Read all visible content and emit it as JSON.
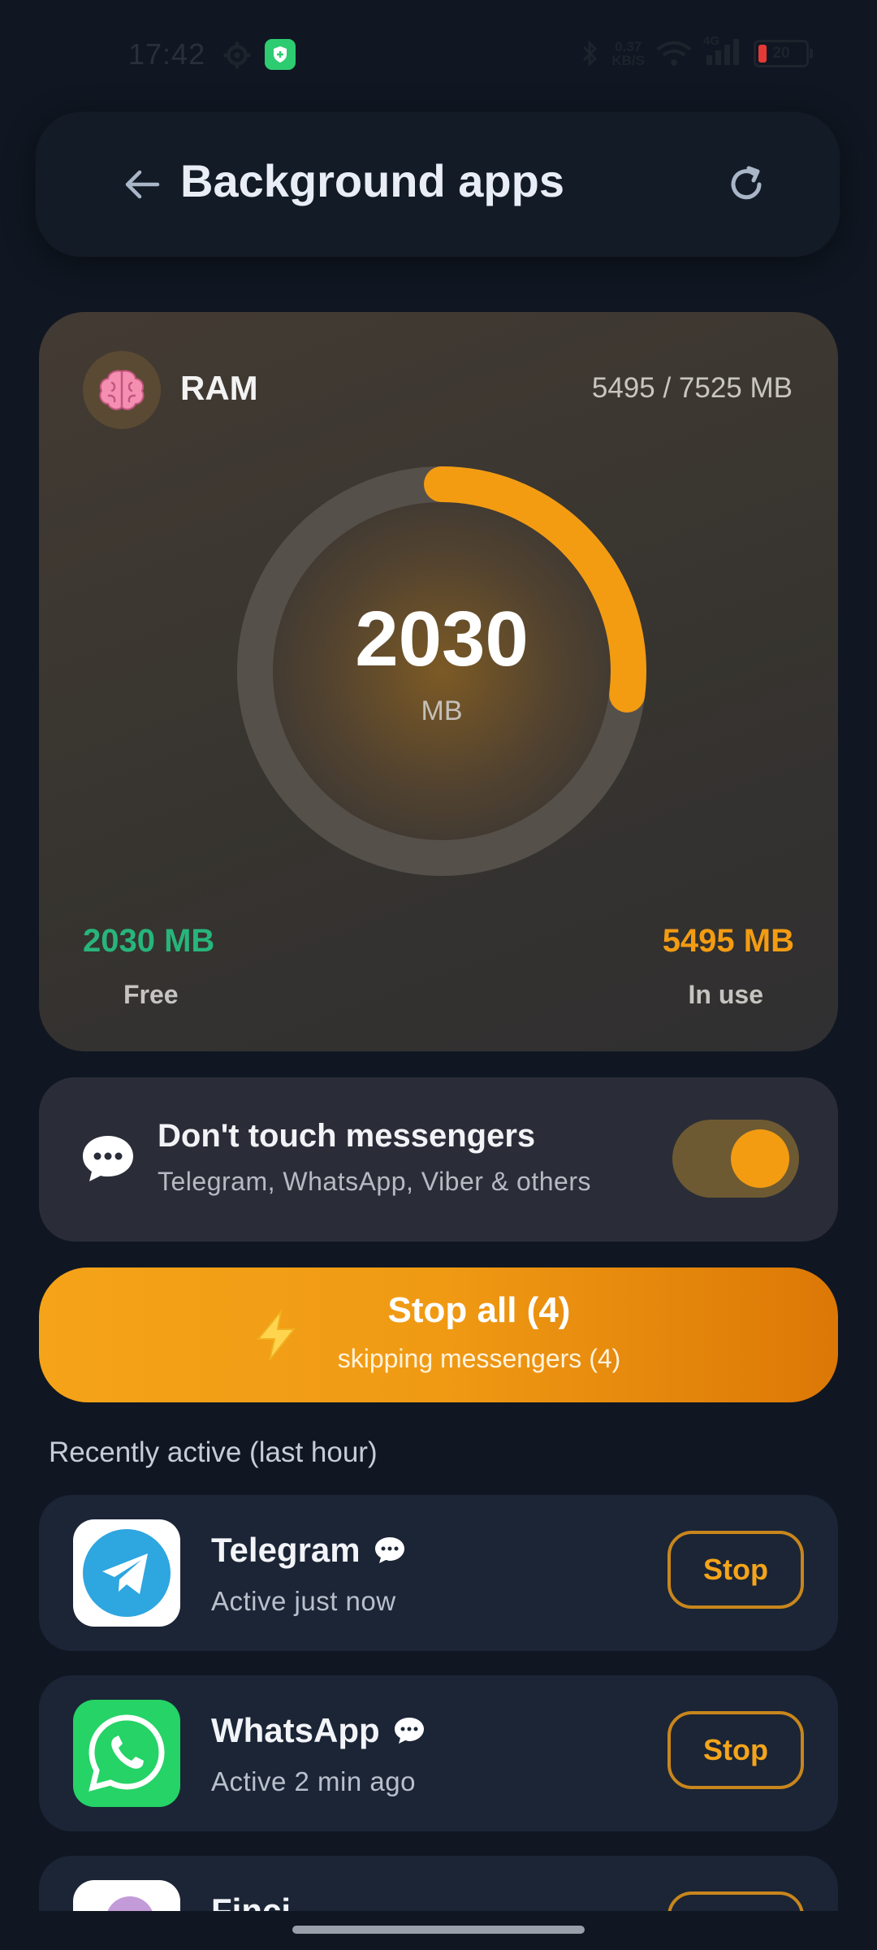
{
  "status_bar": {
    "time": "17:42",
    "net_speed_value": "0.37",
    "net_speed_unit": "KB/S",
    "network_type": "4G",
    "battery": "20"
  },
  "header": {
    "title": "Background apps"
  },
  "ram": {
    "label": "RAM",
    "total": "5495 / 7525 MB",
    "gauge_value": "2030",
    "gauge_unit": "MB",
    "used_fraction": 0.27,
    "free_value": "2030 MB",
    "free_label": "Free",
    "used_value": "5495 MB",
    "used_label": "In use"
  },
  "messengers_toggle": {
    "title": "Don't touch messengers",
    "subtitle": "Telegram, WhatsApp, Viber & others",
    "enabled": true
  },
  "stop_all": {
    "title": "Stop all (4)",
    "subtitle": "skipping messengers (4)"
  },
  "recent": {
    "title": "Recently active (last hour)",
    "apps": [
      {
        "name": "Telegram",
        "status": "Active just now",
        "stop_label": "Stop",
        "messenger": true
      },
      {
        "name": "WhatsApp",
        "status": "Active 2 min ago",
        "stop_label": "Stop",
        "messenger": true
      },
      {
        "name": "Finci",
        "status": "",
        "stop_label": "Stop",
        "messenger": false
      }
    ]
  },
  "colors": {
    "accent": "#f39c12",
    "free": "#27b57b",
    "background": "#101722",
    "card": "#1b2536"
  }
}
